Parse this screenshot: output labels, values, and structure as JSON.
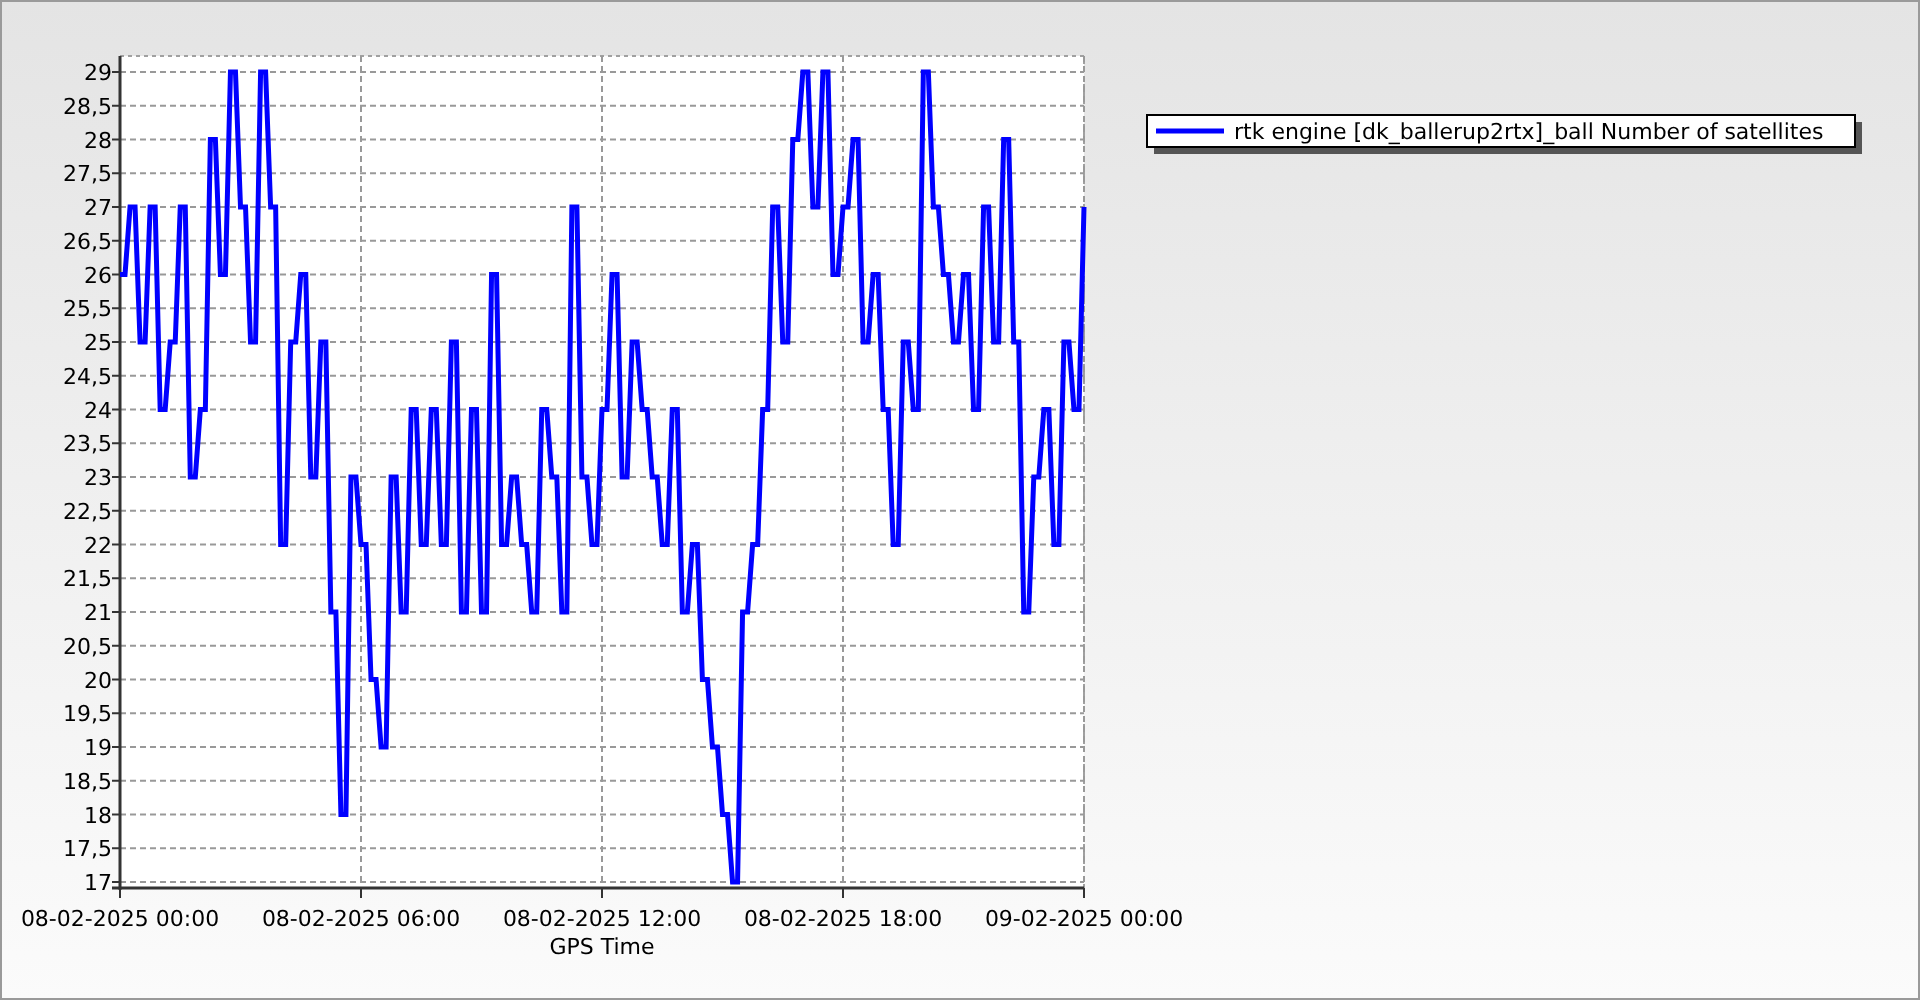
{
  "chart": {
    "chart_data": {
      "type": "line",
      "grid": true,
      "xlabel": "GPS Time",
      "ylim": [
        17,
        29
      ],
      "yticks": [
        17,
        {
          "value": 17.5,
          "label": "17,5"
        },
        18,
        {
          "value": 18.5,
          "label": "18,5"
        },
        19,
        {
          "value": 19.5,
          "label": "19,5"
        },
        20,
        {
          "value": 20.5,
          "label": "20,5"
        },
        21,
        {
          "value": 21.5,
          "label": "21,5"
        },
        22,
        {
          "value": 22.5,
          "label": "22,5"
        },
        23,
        {
          "value": 23.5,
          "label": "23,5"
        },
        24,
        {
          "value": 24.5,
          "label": "24,5"
        },
        25,
        {
          "value": 25.5,
          "label": "25,5"
        },
        26,
        {
          "value": 26.5,
          "label": "26,5"
        },
        27,
        {
          "value": 27.5,
          "label": "27,5"
        },
        28,
        {
          "value": 28.5,
          "label": "28,5"
        },
        29
      ],
      "categories": [
        "08-02-2025 00:00",
        null,
        null,
        null,
        null,
        null,
        null,
        null,
        null,
        null,
        null,
        null,
        null,
        null,
        null,
        null,
        null,
        null,
        null,
        null,
        null,
        null,
        null,
        null,
        null,
        null,
        null,
        null,
        null,
        null,
        null,
        null,
        null,
        null,
        null,
        null,
        null,
        null,
        null,
        null,
        null,
        null,
        null,
        null,
        null,
        null,
        null,
        null,
        "08-02-2025 06:00",
        null,
        null,
        null,
        null,
        null,
        null,
        null,
        null,
        null,
        null,
        null,
        null,
        null,
        null,
        null,
        null,
        null,
        null,
        null,
        null,
        null,
        null,
        null,
        null,
        null,
        null,
        null,
        null,
        null,
        null,
        null,
        null,
        null,
        null,
        null,
        null,
        null,
        null,
        null,
        null,
        null,
        null,
        null,
        null,
        null,
        null,
        null,
        "08-02-2025 12:00",
        null,
        null,
        null,
        null,
        null,
        null,
        null,
        null,
        null,
        null,
        null,
        null,
        null,
        null,
        null,
        null,
        null,
        null,
        null,
        null,
        null,
        null,
        null,
        null,
        null,
        null,
        null,
        null,
        null,
        null,
        null,
        null,
        null,
        null,
        null,
        null,
        null,
        null,
        null,
        null,
        null,
        null,
        null,
        null,
        null,
        null,
        null,
        "08-02-2025 18:00",
        null,
        null,
        null,
        null,
        null,
        null,
        null,
        null,
        null,
        null,
        null,
        null,
        null,
        null,
        null,
        null,
        null,
        null,
        null,
        null,
        null,
        null,
        null,
        null,
        null,
        null,
        null,
        null,
        null,
        null,
        null,
        null,
        null,
        null,
        null,
        null,
        null,
        null,
        null,
        null,
        null,
        null,
        null,
        null,
        null,
        null,
        null,
        "09-02-2025 00:00"
      ],
      "series": [
        {
          "name": "rtk engine [dk_ballerup2rtx]_ball Number of satellites",
          "color": "#0000ff",
          "values": [
            26,
            26,
            27,
            27,
            25,
            25,
            27,
            27,
            24,
            24,
            25,
            25,
            27,
            27,
            23,
            23,
            24,
            24,
            28,
            28,
            26,
            26,
            29,
            29,
            27,
            27,
            25,
            25,
            29,
            29,
            27,
            27,
            22,
            22,
            25,
            25,
            26,
            26,
            23,
            23,
            25,
            25,
            21,
            21,
            18,
            18,
            23,
            23,
            22,
            22,
            20,
            20,
            19,
            19,
            23,
            23,
            21,
            21,
            24,
            24,
            22,
            22,
            24,
            24,
            22,
            22,
            25,
            25,
            21,
            21,
            24,
            24,
            21,
            21,
            26,
            26,
            22,
            22,
            23,
            23,
            22,
            22,
            21,
            21,
            24,
            24,
            23,
            23,
            21,
            21,
            27,
            27,
            23,
            23,
            22,
            22,
            24,
            24,
            26,
            26,
            23,
            23,
            25,
            25,
            24,
            24,
            23,
            23,
            22,
            22,
            24,
            24,
            21,
            21,
            22,
            22,
            20,
            20,
            19,
            19,
            18,
            18,
            17,
            17,
            21,
            21,
            22,
            22,
            24,
            24,
            27,
            27,
            25,
            25,
            28,
            28,
            29,
            29,
            27,
            27,
            29,
            29,
            26,
            26,
            27,
            27,
            28,
            28,
            25,
            25,
            26,
            26,
            24,
            24,
            22,
            22,
            25,
            25,
            24,
            24,
            29,
            29,
            27,
            27,
            26,
            26,
            25,
            25,
            26,
            26,
            24,
            24,
            27,
            27,
            25,
            25,
            28,
            28,
            25,
            25,
            21,
            21,
            23,
            23,
            24,
            24,
            22,
            22,
            25,
            25,
            24,
            24,
            27
          ]
        }
      ]
    }
  }
}
